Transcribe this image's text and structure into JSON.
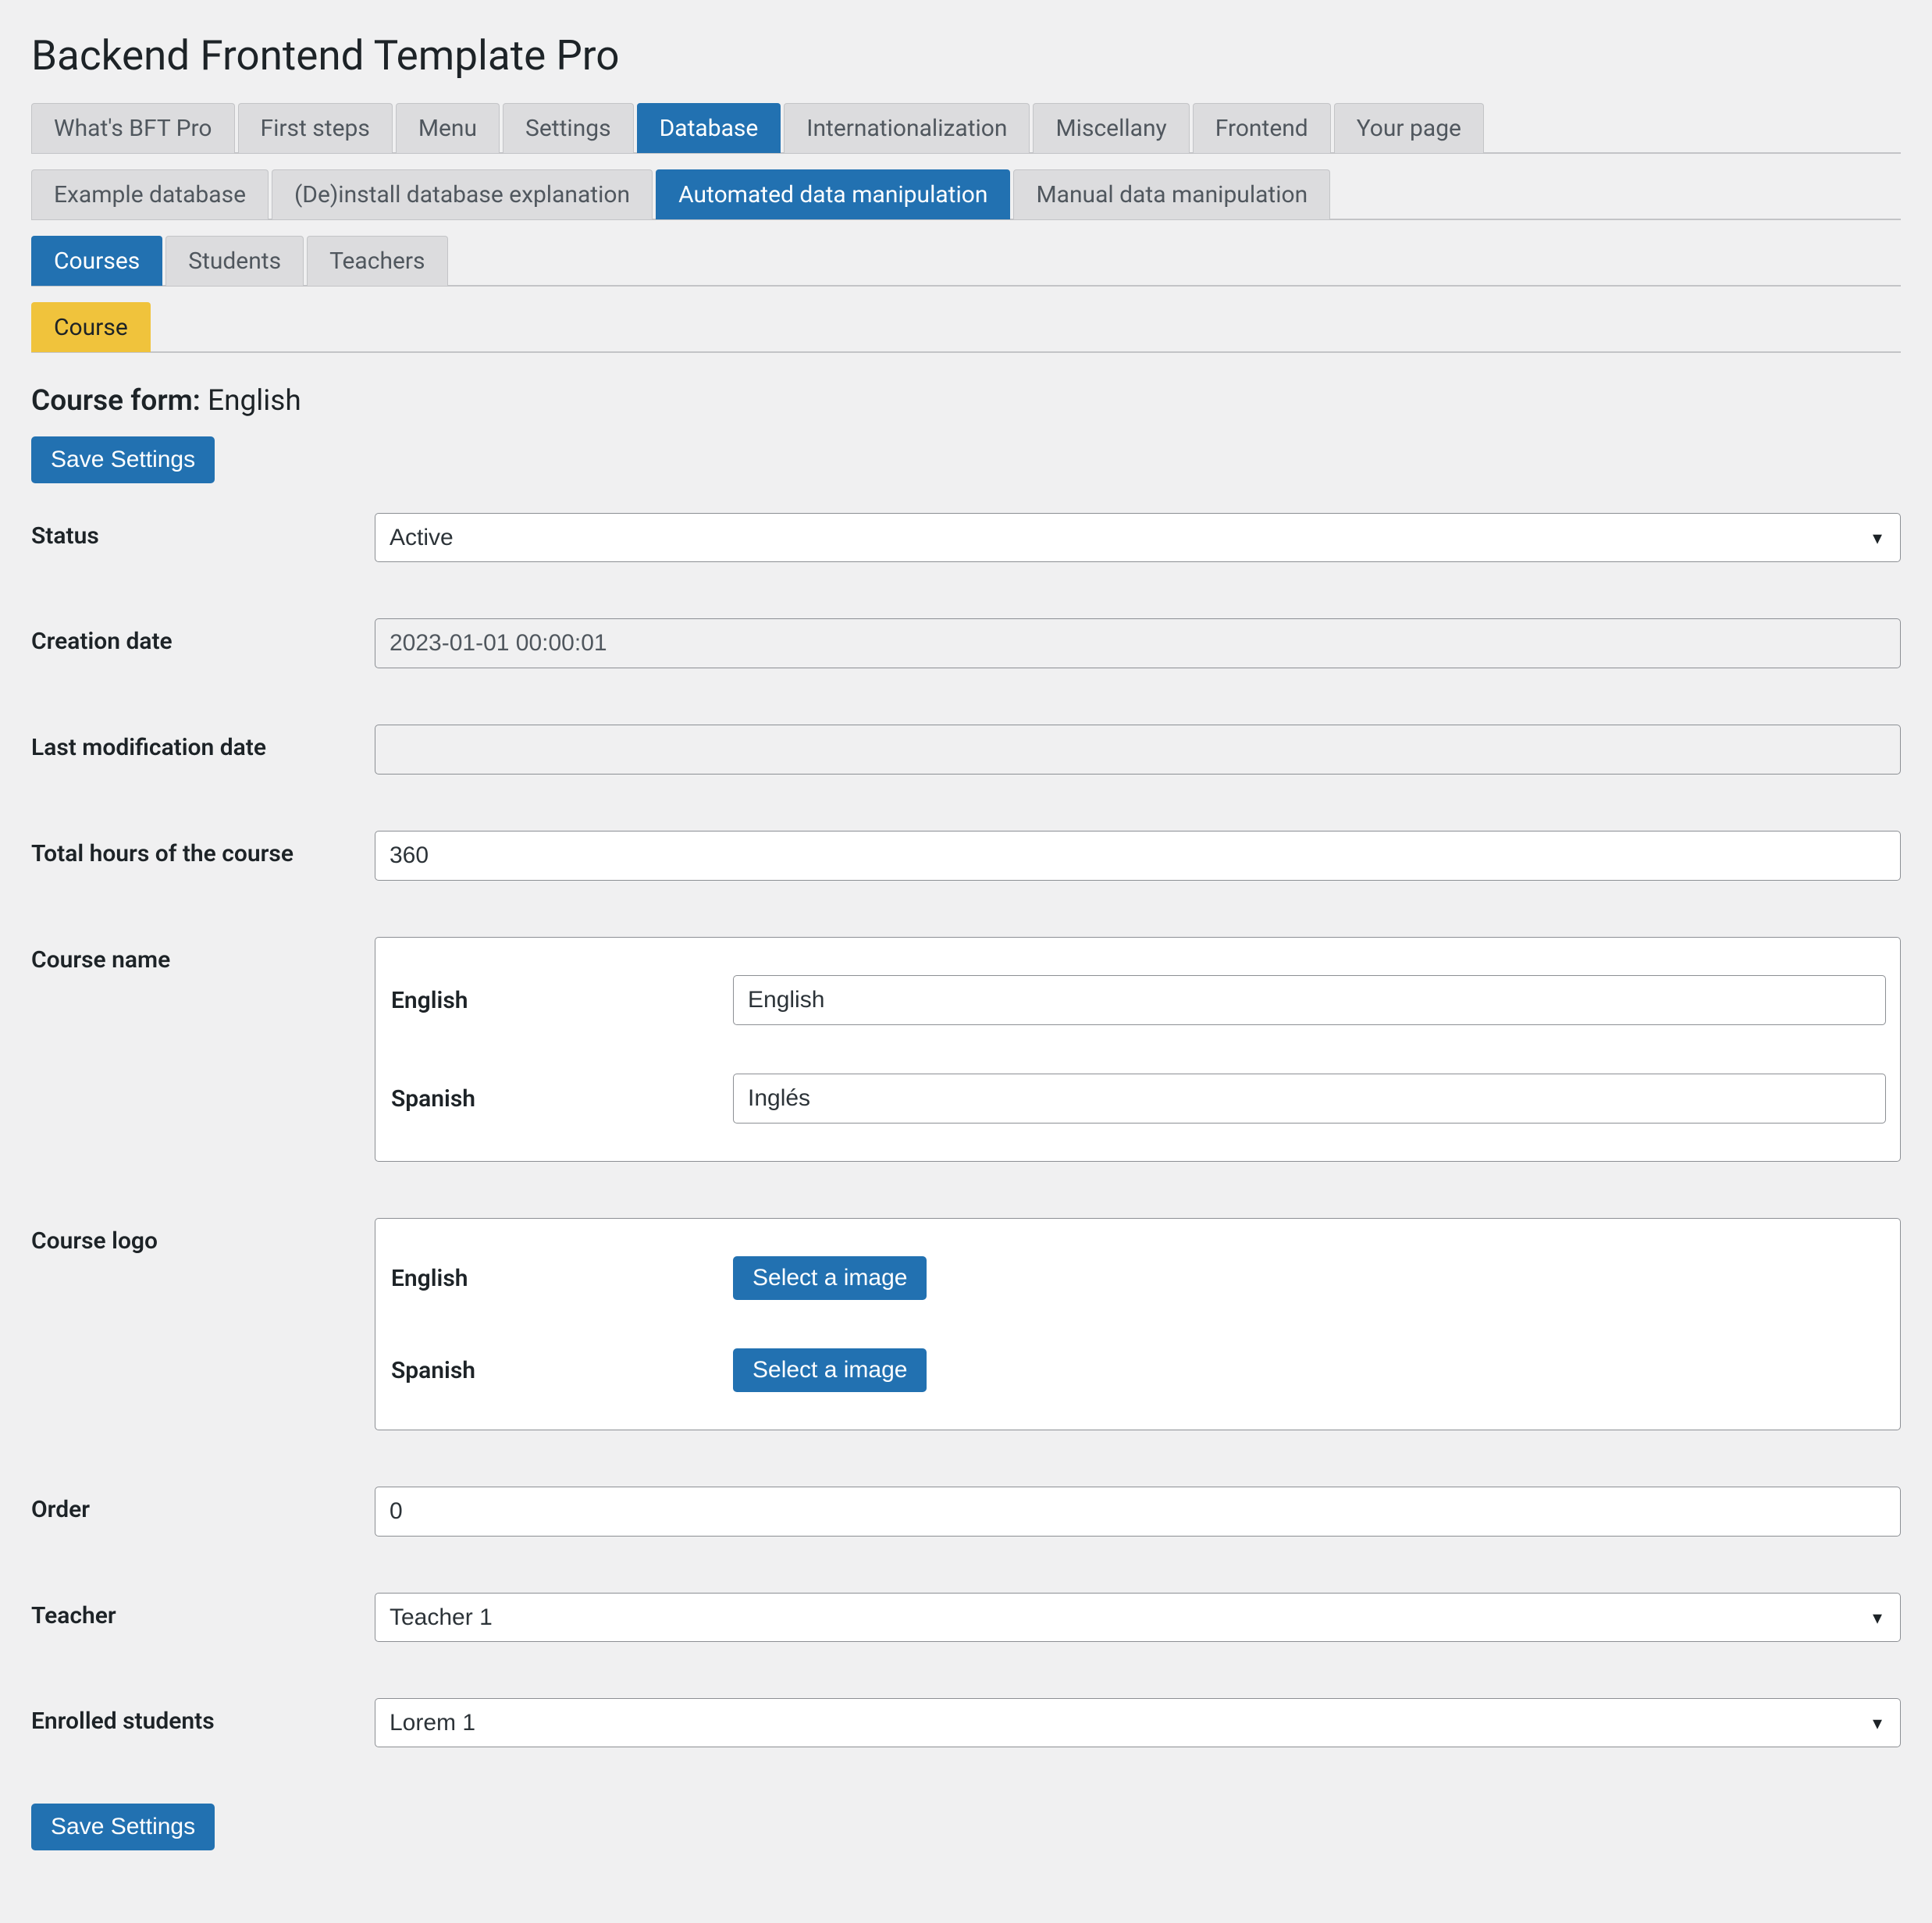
{
  "page_title": "Backend Frontend Template Pro",
  "top_tabs": [
    {
      "label": "What's BFT Pro",
      "active": false
    },
    {
      "label": "First steps",
      "active": false
    },
    {
      "label": "Menu",
      "active": false
    },
    {
      "label": "Settings",
      "active": false
    },
    {
      "label": "Database",
      "active": true
    },
    {
      "label": "Internationalization",
      "active": false
    },
    {
      "label": "Miscellany",
      "active": false
    },
    {
      "label": "Frontend",
      "active": false
    },
    {
      "label": "Your page",
      "active": false
    }
  ],
  "sub_tabs": [
    {
      "label": "Example database",
      "active": false
    },
    {
      "label": "(De)install database explanation",
      "active": false
    },
    {
      "label": "Automated data manipulation",
      "active": true
    },
    {
      "label": "Manual data manipulation",
      "active": false
    }
  ],
  "sub_tabs_2": [
    {
      "label": "Courses",
      "active": true
    },
    {
      "label": "Students",
      "active": false
    },
    {
      "label": "Teachers",
      "active": false
    }
  ],
  "sub_tabs_3": [
    {
      "label": "Course",
      "active_yellow": true
    }
  ],
  "heading_label": "Course form:",
  "heading_value": "English",
  "save_button": "Save Settings",
  "fields": {
    "status": {
      "label": "Status",
      "value": "Active"
    },
    "creation_date": {
      "label": "Creation date",
      "value": "2023-01-01 00:00:01"
    },
    "last_mod": {
      "label": "Last modification date",
      "value": ""
    },
    "total_hours": {
      "label": "Total hours of the course",
      "value": "360"
    },
    "course_name": {
      "label": "Course name",
      "english_label": "English",
      "english_value": "English",
      "spanish_label": "Spanish",
      "spanish_value": "Inglés"
    },
    "course_logo": {
      "label": "Course logo",
      "english_label": "English",
      "spanish_label": "Spanish",
      "select_image_label": "Select a image"
    },
    "order": {
      "label": "Order",
      "value": "0"
    },
    "teacher": {
      "label": "Teacher",
      "value": "Teacher 1"
    },
    "enrolled": {
      "label": "Enrolled students",
      "value": "Lorem 1"
    }
  }
}
